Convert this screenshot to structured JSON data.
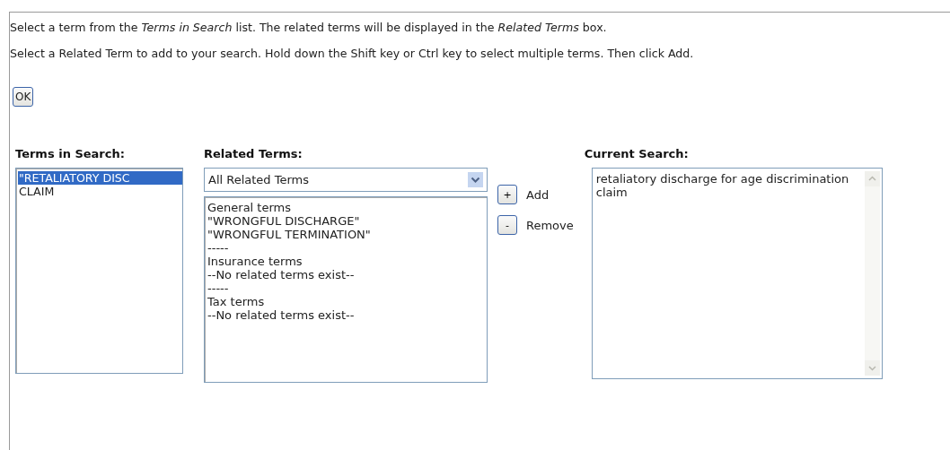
{
  "instructions": [
    "Select a term from the *Terms in Search* list. The related terms will be displayed in the *Related Terms* box.",
    "Select a Related Term to add to your search. Hold down the Shift key or Ctrl key to select multiple terms. Then click Add."
  ],
  "ok_button": "OK",
  "terms_in_search": {
    "heading": "Terms in Search:",
    "items": [
      {
        "label": "\"RETALIATORY DISC",
        "selected": true
      },
      {
        "label": "CLAIM",
        "selected": false
      }
    ]
  },
  "related_terms": {
    "heading": "Related Terms:",
    "filter": "All Related Terms",
    "items": [
      "General terms",
      "\"WRONGFUL DISCHARGE\"",
      "\"WRONGFUL TERMINATION\"",
      "-----",
      "Insurance terms",
      "--No related terms exist--",
      "-----",
      "Tax terms",
      "--No related terms exist--"
    ]
  },
  "actions": [
    {
      "icon": "+",
      "label": "Add"
    },
    {
      "icon": "-",
      "label": "Remove"
    }
  ],
  "current_search": {
    "heading": "Current Search:",
    "value": "retaliatory discharge for age discrimination claim"
  }
}
